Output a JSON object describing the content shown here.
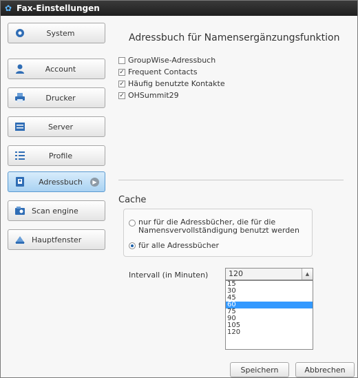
{
  "window": {
    "title": "Fax-Einstellungen"
  },
  "sidebar": {
    "items": [
      {
        "label": "System",
        "icon": "gear-icon"
      },
      {
        "label": "Account",
        "icon": "user-icon"
      },
      {
        "label": "Drucker",
        "icon": "printer-icon"
      },
      {
        "label": "Server",
        "icon": "server-icon"
      },
      {
        "label": "Profile",
        "icon": "list-icon"
      },
      {
        "label": "Adressbuch",
        "icon": "addressbook-icon",
        "active": true
      },
      {
        "label": "Scan engine",
        "icon": "scan-icon"
      },
      {
        "label": "Hauptfenster",
        "icon": "home-icon"
      }
    ]
  },
  "addressbook": {
    "heading": "Adressbuch für Namensergänzungsfunktion",
    "items": [
      {
        "label": "GroupWise-Adressbuch",
        "checked": false
      },
      {
        "label": "Frequent Contacts",
        "checked": true
      },
      {
        "label": "Häufig benutzte Kontakte",
        "checked": true
      },
      {
        "label": "OHSummit29",
        "checked": true
      }
    ]
  },
  "cache": {
    "heading": "Cache",
    "option_used": "nur für die Adressbücher, die für die Namensvervollständigung benutzt werden",
    "option_all": "für alle Adressbücher",
    "selected": "all",
    "interval_label": "Intervall (in Minuten)",
    "interval_value": "120",
    "interval_options": [
      "15",
      "30",
      "45",
      "60",
      "75",
      "90",
      "105",
      "120"
    ],
    "highlighted_option": "60"
  },
  "footer": {
    "save_label": "Speichern",
    "cancel_label": "Abbrechen"
  },
  "colors": {
    "accent": "#3399ff",
    "active_nav": "#a9d2f2",
    "titlebar": "#2a2a2a"
  }
}
